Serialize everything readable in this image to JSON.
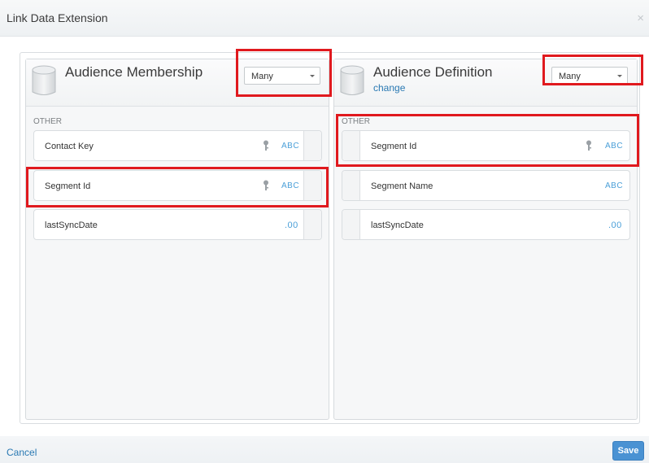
{
  "dialog": {
    "title": "Link Data Extension",
    "close_glyph": "×"
  },
  "left_panel": {
    "title": "Audience Membership",
    "cardinality": "Many",
    "section_label": "OTHER",
    "fields": [
      {
        "name": "Contact Key",
        "type": "ABC",
        "is_key": true
      },
      {
        "name": "Segment Id",
        "type": "ABC",
        "is_key": true
      },
      {
        "name": "lastSyncDate",
        "type": ".00",
        "is_key": false
      }
    ]
  },
  "right_panel": {
    "title": "Audience Definition",
    "change_label": "change",
    "cardinality": "Many",
    "section_label": "OTHER",
    "fields": [
      {
        "name": "Segment Id",
        "type": "ABC",
        "is_key": true
      },
      {
        "name": "Segment Name",
        "type": "ABC",
        "is_key": false
      },
      {
        "name": "lastSyncDate",
        "type": ".00",
        "is_key": false
      }
    ]
  },
  "footer": {
    "cancel_label": "Cancel",
    "save_label": "Save"
  },
  "colors": {
    "highlight": "#e0191e",
    "link": "#2a79b3",
    "type_badge": "#4a9fd8",
    "save_button": "#4a92d3"
  }
}
